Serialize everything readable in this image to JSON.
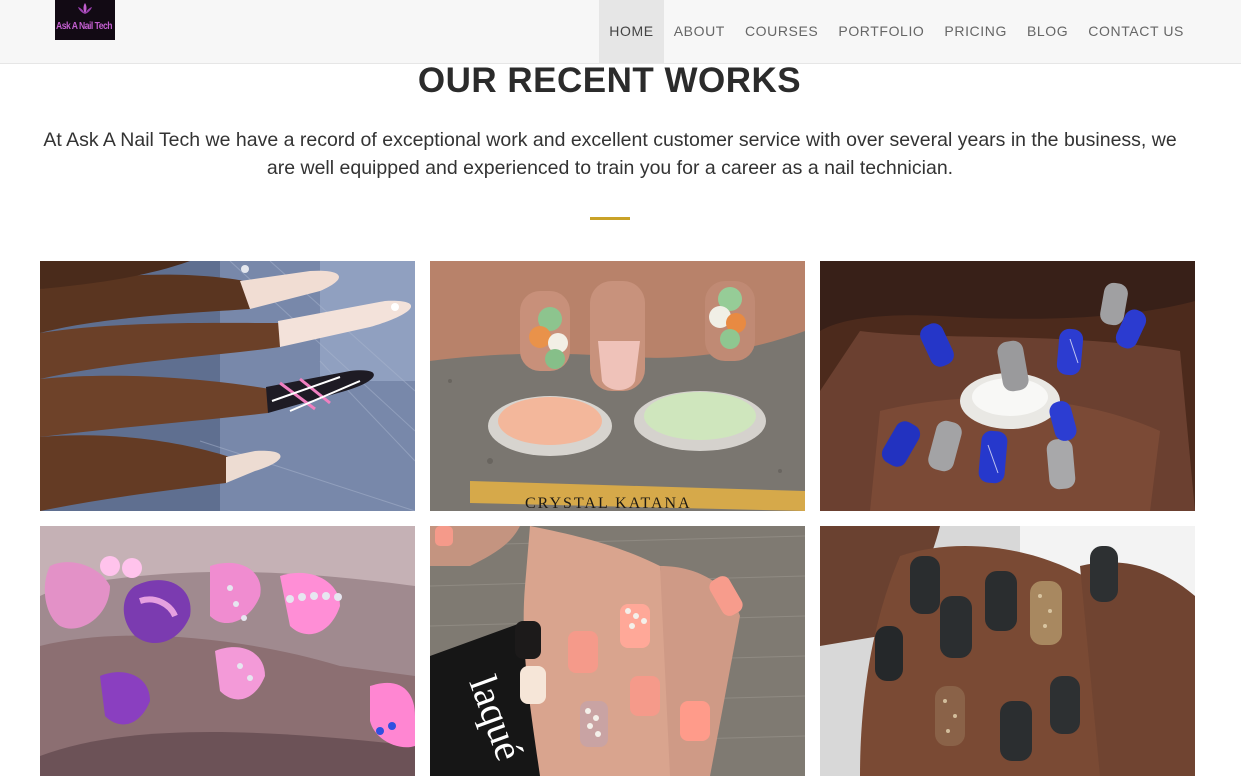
{
  "brand": {
    "logo_text": "Ask A Nail Tech",
    "logo_color": "#c35fd0",
    "logo_background": "#120a14"
  },
  "nav": {
    "items": [
      "HOME",
      "ABOUT",
      "COURSES",
      "PORTFOLIO",
      "PRICING",
      "BLOG",
      "CONTACT US"
    ],
    "active": "HOME"
  },
  "section": {
    "title": "OUR RECENT WORKS",
    "description": "At Ask A Nail Tech we have a record of exceptional work and excellent customer service with over several years in the business, we are well equipped and experienced to train you for a career as a nail technician.",
    "divider_color": "#c9a227"
  },
  "gallery": {
    "brush_text": "CRYSTAL KATANA",
    "bottle_text": "laqué"
  }
}
